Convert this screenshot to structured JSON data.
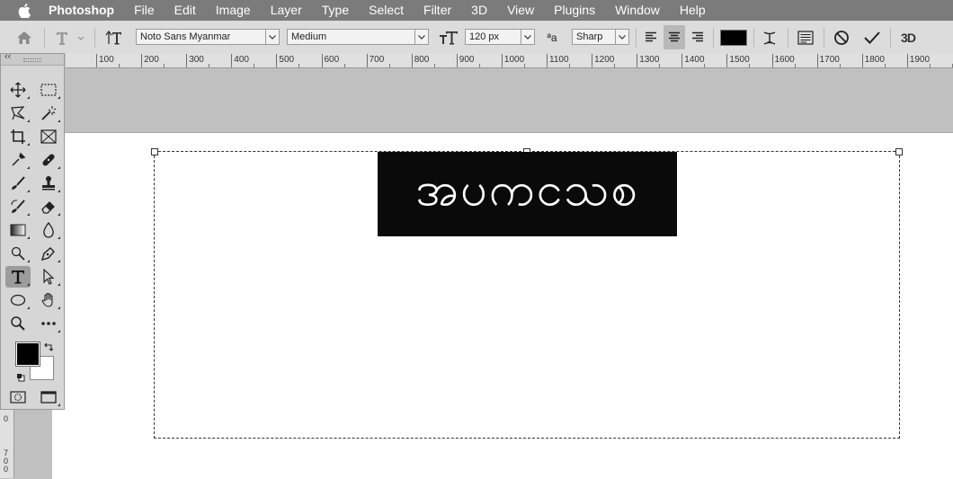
{
  "menubar": {
    "items": [
      "Photoshop",
      "File",
      "Edit",
      "Image",
      "Layer",
      "Type",
      "Select",
      "Filter",
      "3D",
      "View",
      "Plugins",
      "Window",
      "Help"
    ]
  },
  "options": {
    "font_family": "Noto Sans Myanmar",
    "font_style": "Medium",
    "font_size": "120 px",
    "antialias_label": "ªa",
    "antialias": "Sharp",
    "color": "#000000"
  },
  "ruler": {
    "labels": [
      "100",
      "200",
      "300",
      "400",
      "500",
      "600",
      "700",
      "800",
      "900",
      "1000",
      "1100",
      "1200",
      "1300",
      "1400",
      "1500",
      "1600",
      "1700",
      "1800",
      "1900"
    ]
  },
  "vruler": {
    "label_a": "0",
    "label_b": "7 0 0"
  },
  "canvas": {
    "sample_text": "အပကငသစ",
    "sample_bg": "#0a0a0a"
  },
  "tools": {
    "fg_color": "#000000",
    "bg_color": "#ffffff",
    "collapse_label": "‹‹"
  }
}
